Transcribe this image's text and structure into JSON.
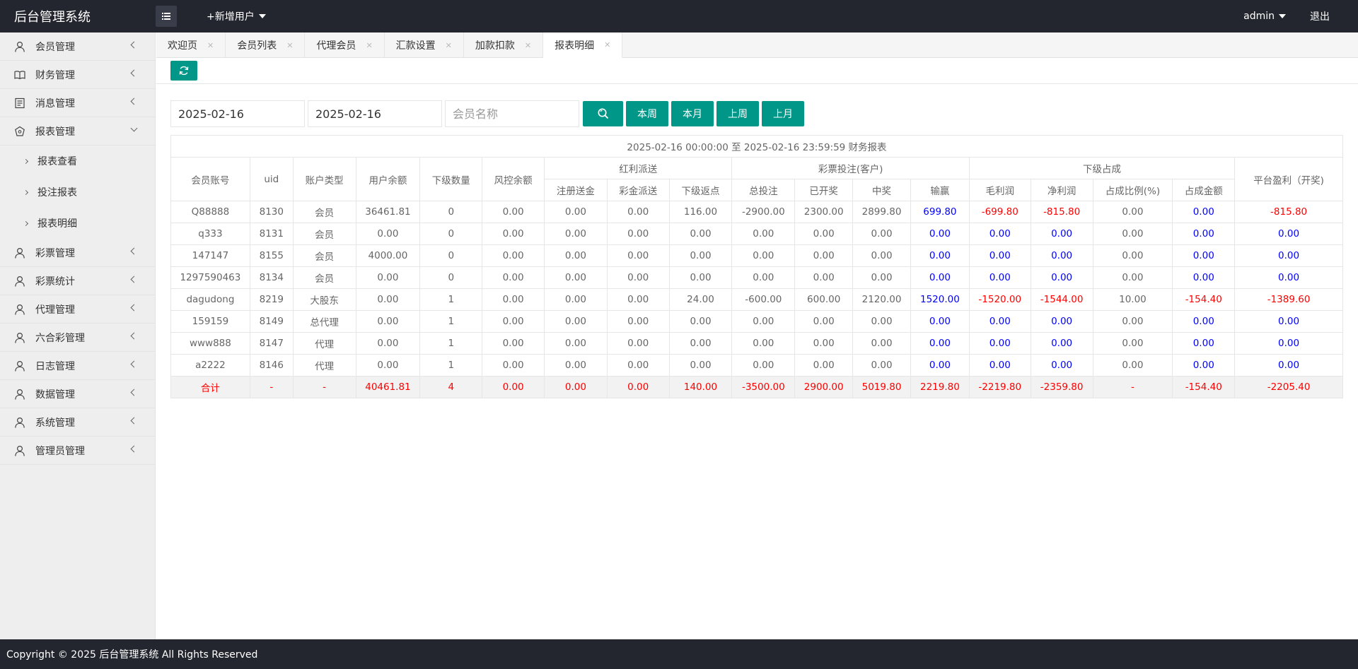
{
  "header": {
    "logo": "后台管理系统",
    "add_user": "+新增用户",
    "admin": "admin",
    "logout": "退出"
  },
  "sidebar": {
    "items": [
      {
        "label": "会员管理",
        "icon": "user-icon"
      },
      {
        "label": "财务管理",
        "icon": "book-icon"
      },
      {
        "label": "消息管理",
        "icon": "message-icon"
      },
      {
        "label": "报表管理",
        "icon": "report-icon",
        "open": true,
        "children": [
          "报表查看",
          "投注报表",
          "报表明细"
        ]
      },
      {
        "label": "彩票管理",
        "icon": "user-icon"
      },
      {
        "label": "彩票统计",
        "icon": "user-icon"
      },
      {
        "label": "代理管理",
        "icon": "user-icon"
      },
      {
        "label": "六合彩管理",
        "icon": "user-icon"
      },
      {
        "label": "日志管理",
        "icon": "user-icon"
      },
      {
        "label": "数据管理",
        "icon": "user-icon"
      },
      {
        "label": "系统管理",
        "icon": "user-icon"
      },
      {
        "label": "管理员管理",
        "icon": "user-icon"
      }
    ]
  },
  "tabs": [
    {
      "label": "欢迎页"
    },
    {
      "label": "会员列表"
    },
    {
      "label": "代理会员"
    },
    {
      "label": "汇款设置"
    },
    {
      "label": "加款扣款"
    },
    {
      "label": "报表明细",
      "active": true
    }
  ],
  "search": {
    "start_date": "2025-02-16",
    "end_date": "2025-02-16",
    "member_placeholder": "会员名称",
    "buttons": [
      "本周",
      "本月",
      "上周",
      "上月"
    ]
  },
  "report": {
    "caption": "2025-02-16 00:00:00 至 2025-02-16 23:59:59 财务报表",
    "headers": {
      "account": "会员账号",
      "uid": "uid",
      "type": "账户类型",
      "balance": "用户余额",
      "sub_count": "下级数量",
      "risk_balance": "风控余额",
      "bonus_group": "红利派送",
      "bonus_cols": [
        "注册送金",
        "彩金派送",
        "下级返点"
      ],
      "lottery_group": "彩票投注(客户)",
      "lottery_cols": [
        "总投注",
        "已开奖",
        "中奖",
        "输赢"
      ],
      "sub_group": "下级占成",
      "sub_cols": [
        "毛利润",
        "净利润",
        "占成比例(%)",
        "占成金额"
      ],
      "platform": "平台盈利（开奖)"
    },
    "rows": [
      [
        "Q88888",
        "8130",
        "会员",
        "36461.81",
        "0",
        "0.00",
        "0.00",
        "0.00",
        "116.00",
        "-2900.00",
        "2300.00",
        "2899.80",
        "699.80",
        "-699.80",
        "-815.80",
        "0.00",
        "0.00",
        "-815.80"
      ],
      [
        "q333",
        "8131",
        "会员",
        "0.00",
        "0",
        "0.00",
        "0.00",
        "0.00",
        "0.00",
        "0.00",
        "0.00",
        "0.00",
        "0.00",
        "0.00",
        "0.00",
        "0.00",
        "0.00",
        "0.00"
      ],
      [
        "147147",
        "8155",
        "会员",
        "4000.00",
        "0",
        "0.00",
        "0.00",
        "0.00",
        "0.00",
        "0.00",
        "0.00",
        "0.00",
        "0.00",
        "0.00",
        "0.00",
        "0.00",
        "0.00",
        "0.00"
      ],
      [
        "1297590463",
        "8134",
        "会员",
        "0.00",
        "0",
        "0.00",
        "0.00",
        "0.00",
        "0.00",
        "0.00",
        "0.00",
        "0.00",
        "0.00",
        "0.00",
        "0.00",
        "0.00",
        "0.00",
        "0.00"
      ],
      [
        "dagudong",
        "8219",
        "大股东",
        "0.00",
        "1",
        "0.00",
        "0.00",
        "0.00",
        "24.00",
        "-600.00",
        "600.00",
        "2120.00",
        "1520.00",
        "-1520.00",
        "-1544.00",
        "10.00",
        "-154.40",
        "-1389.60"
      ],
      [
        "159159",
        "8149",
        "总代理",
        "0.00",
        "1",
        "0.00",
        "0.00",
        "0.00",
        "0.00",
        "0.00",
        "0.00",
        "0.00",
        "0.00",
        "0.00",
        "0.00",
        "0.00",
        "0.00",
        "0.00"
      ],
      [
        "www888",
        "8147",
        "代理",
        "0.00",
        "1",
        "0.00",
        "0.00",
        "0.00",
        "0.00",
        "0.00",
        "0.00",
        "0.00",
        "0.00",
        "0.00",
        "0.00",
        "0.00",
        "0.00",
        "0.00"
      ],
      [
        "a2222",
        "8146",
        "代理",
        "0.00",
        "1",
        "0.00",
        "0.00",
        "0.00",
        "0.00",
        "0.00",
        "0.00",
        "0.00",
        "0.00",
        "0.00",
        "0.00",
        "0.00",
        "0.00",
        "0.00"
      ]
    ],
    "total": [
      "合计",
      "-",
      "-",
      "40461.81",
      "4",
      "0.00",
      "0.00",
      "0.00",
      "140.00",
      "-3500.00",
      "2900.00",
      "5019.80",
      "2219.80",
      "-2219.80",
      "-2359.80",
      "-",
      "-154.40",
      "-2205.40"
    ]
  },
  "colors": {
    "accent": "#009688",
    "header_bg": "#23262e",
    "negative": "#ff0000",
    "positive": "#0000ff"
  },
  "footer": "Copyright © 2025 后台管理系统 All Rights Reserved"
}
